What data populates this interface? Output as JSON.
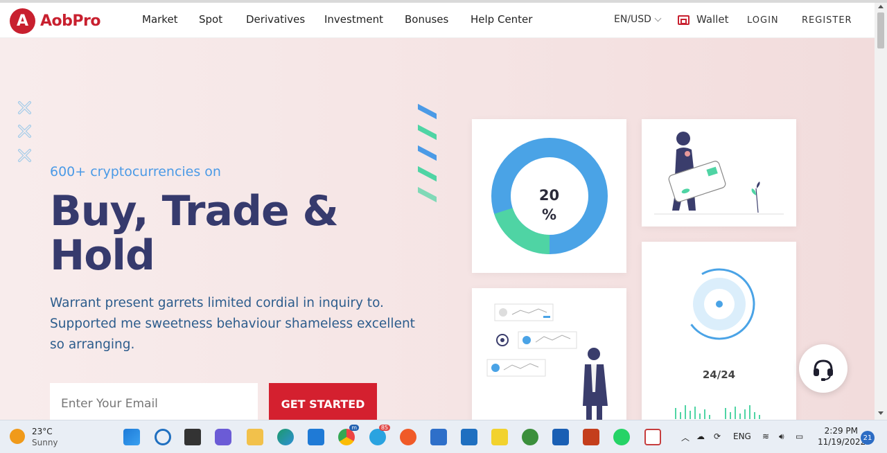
{
  "brand": {
    "logo_letter": "A",
    "name": "AobPro",
    "color": "#c8202f"
  },
  "nav": {
    "items": [
      "Market",
      "Spot",
      "Derivatives",
      "Investment",
      "Bonuses",
      "Help Center"
    ],
    "language": "EN/USD",
    "wallet": "Wallet",
    "login": "LOGIN",
    "register": "REGISTER"
  },
  "hero": {
    "subtitle": "600+ cryptocurrencies on",
    "headline_line1": "Buy, Trade &",
    "headline_line2": "Hold",
    "description": "Warrant present garrets limited cordial in inquiry to. Supported me sweetness behaviour shameless excellent so arranging.",
    "email_placeholder": "Enter Your Email",
    "cta_label": "GET STARTED",
    "accent_blue": "#4b9ae6",
    "accent_green": "#4fd4a4"
  },
  "cards": {
    "donut_value": "20",
    "donut_unit": "%",
    "donut_share": 0.2,
    "support_hours": "24/24"
  },
  "taskbar": {
    "temperature": "23°C",
    "condition": "Sunny",
    "telegram_badge": "85",
    "chrome_badge": "m",
    "language": "ENG",
    "time": "2:29 PM",
    "date": "11/19/2022",
    "notification_count": "21"
  }
}
